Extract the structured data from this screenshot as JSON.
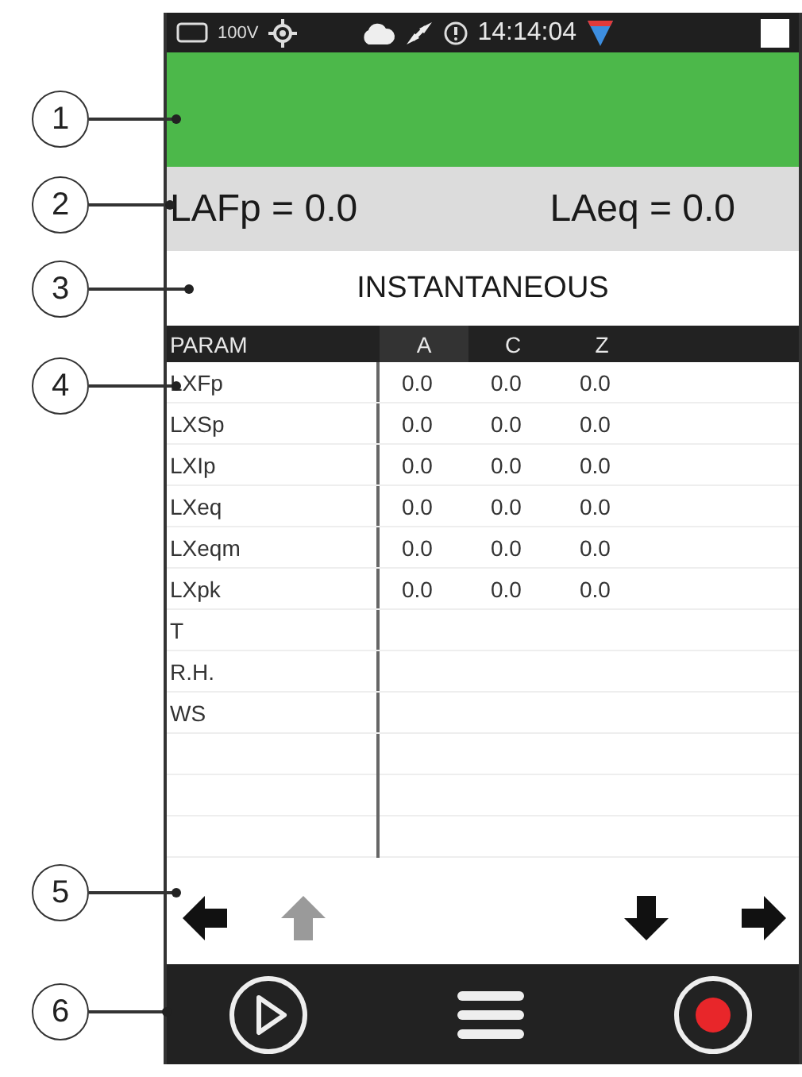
{
  "status_bar": {
    "voltage": "100V",
    "time": "14:14:04"
  },
  "alert_bar": {
    "callout": "1"
  },
  "readout": {
    "callout": "2",
    "items": [
      "LAFp = 0.0",
      "LAeq = 0.0"
    ]
  },
  "mode": {
    "callout": "3",
    "title": "INSTANTANEOUS"
  },
  "table": {
    "callout": "4",
    "columns": [
      "PARAM",
      "A",
      "C",
      "Z"
    ],
    "rows": [
      {
        "param": "LXFp",
        "values": [
          "0.0",
          "0.0",
          "0.0"
        ]
      },
      {
        "param": "LXSp",
        "values": [
          "0.0",
          "0.0",
          "0.0"
        ]
      },
      {
        "param": "LXIp",
        "values": [
          "0.0",
          "0.0",
          "0.0"
        ]
      },
      {
        "param": "LXeq",
        "values": [
          "0.0",
          "0.0",
          "0.0"
        ]
      },
      {
        "param": "LXeqm",
        "values": [
          "0.0",
          "0.0",
          "0.0"
        ]
      },
      {
        "param": "LXpk",
        "values": [
          "0.0",
          "0.0",
          "0.0"
        ]
      },
      {
        "param": "T",
        "values": []
      },
      {
        "param": "R.H.",
        "values": []
      },
      {
        "param": "WS",
        "values": []
      }
    ]
  },
  "navigation": {
    "callout": "5",
    "buttons": [
      {
        "kind": "left",
        "disabled": false
      },
      {
        "kind": "up",
        "disabled": true
      },
      {
        "kind": "down",
        "disabled": false
      },
      {
        "kind": "right",
        "disabled": false
      }
    ]
  },
  "toolbar": {
    "callout": "6",
    "buttons": [
      {
        "kind": "play"
      },
      {
        "kind": "menu"
      },
      {
        "kind": "record"
      }
    ]
  }
}
